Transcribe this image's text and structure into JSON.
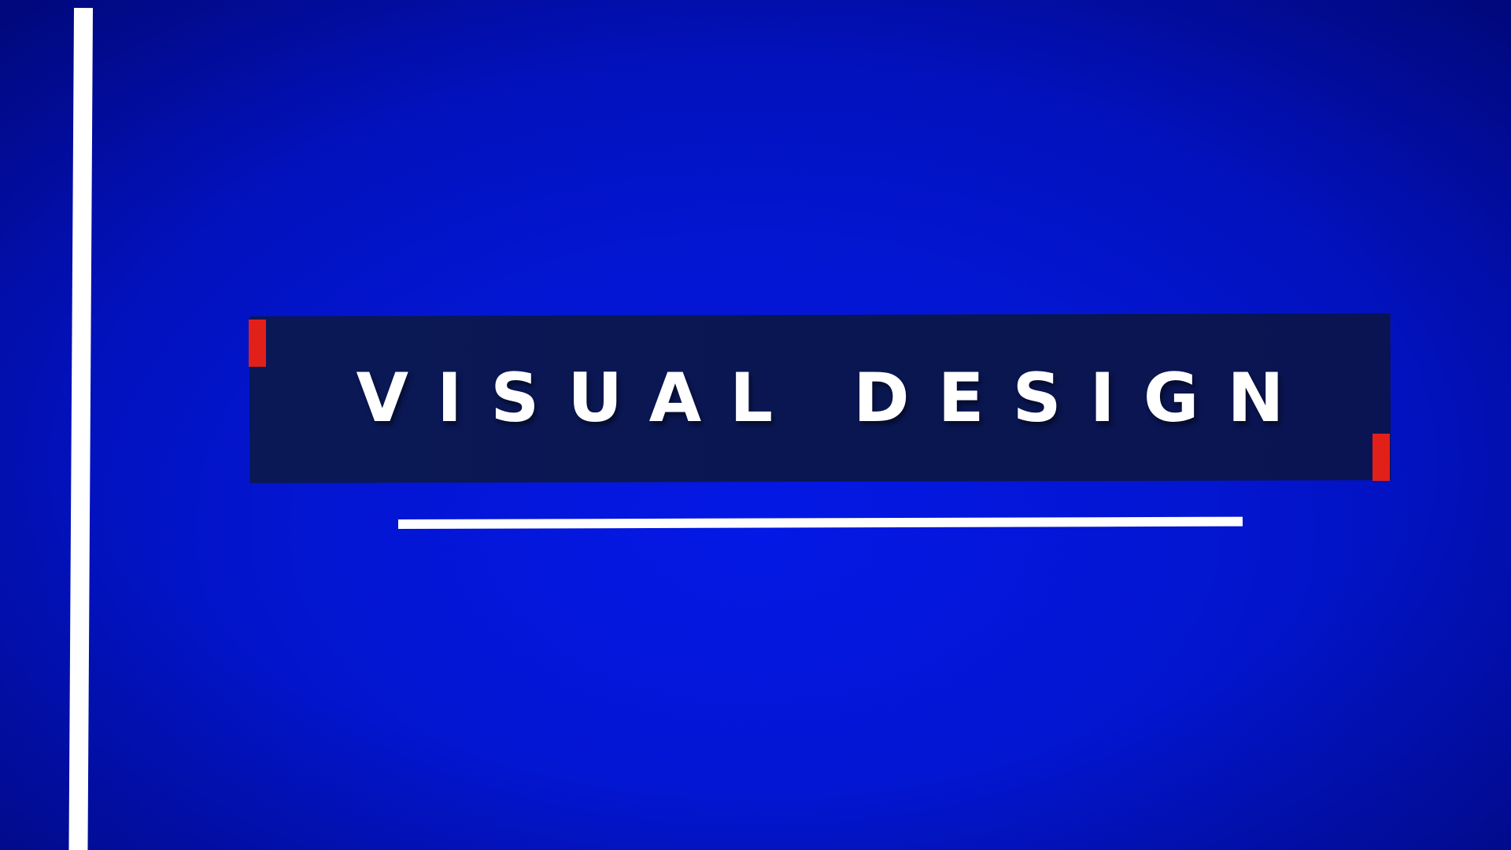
{
  "title": {
    "text": "VISUAL DESIGN"
  },
  "colors": {
    "background": "#0316d2",
    "band": "#0a1650",
    "accent": "#e2201a",
    "rule": "#ffffff"
  }
}
